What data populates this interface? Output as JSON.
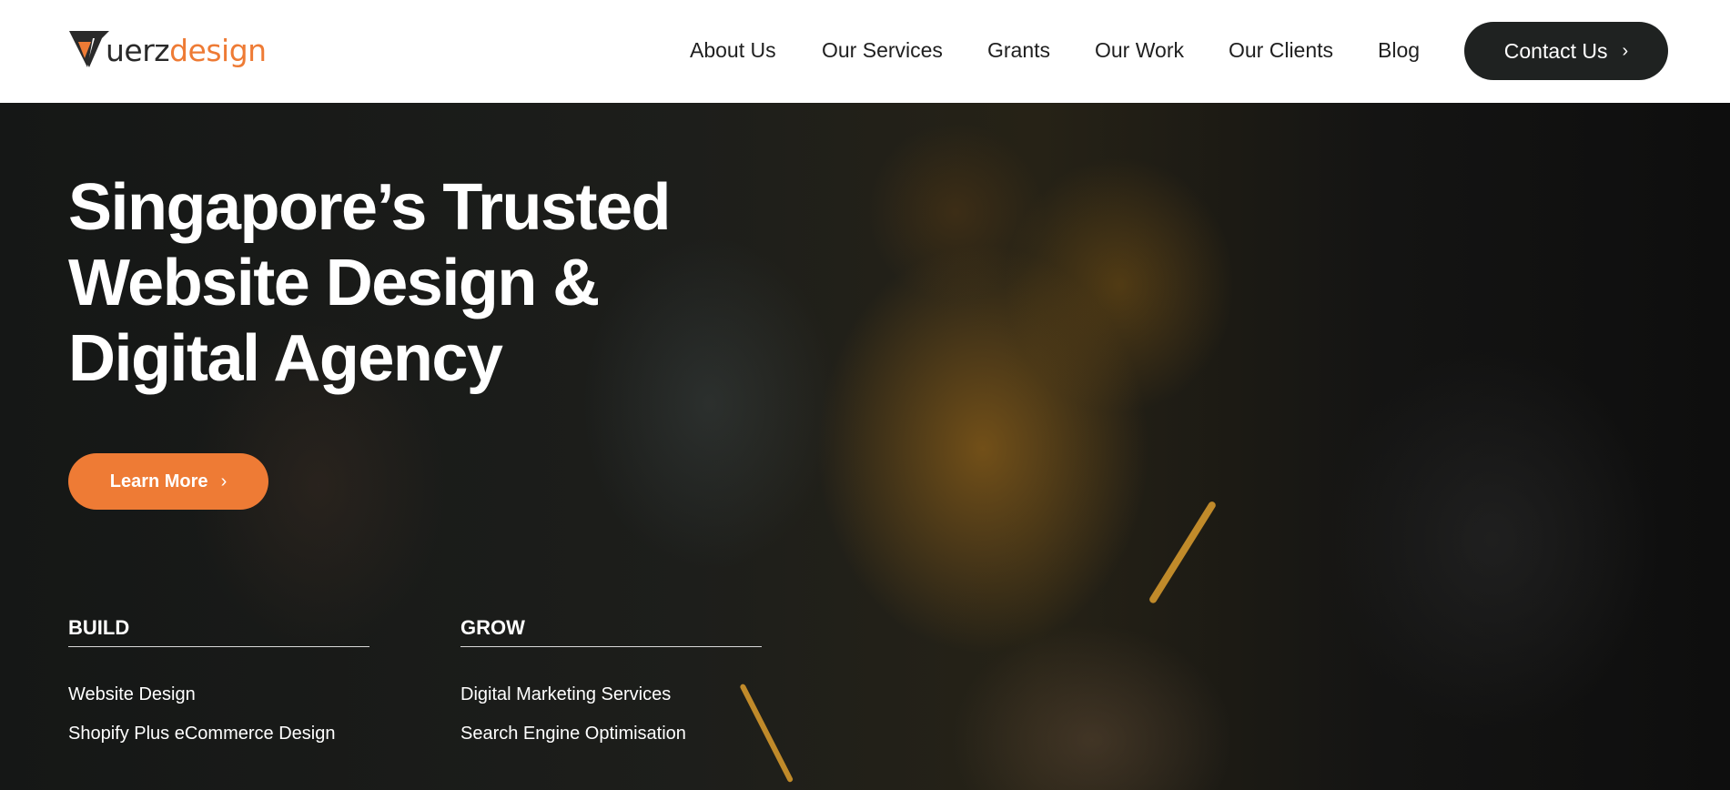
{
  "brand": {
    "logo_part1": "uerz",
    "logo_part2": "design",
    "dark_color": "#2a2a2a",
    "accent_color": "#ee7b35"
  },
  "nav": {
    "items": [
      "About Us",
      "Our Services",
      "Grants",
      "Our Work",
      "Our Clients",
      "Blog"
    ],
    "contact_label": "Contact Us",
    "contact_icon": "chevron-right-icon"
  },
  "hero": {
    "title_lines": [
      "Singapore’s Trusted",
      "Website Design &",
      "Digital Agency"
    ],
    "cta_label": "Learn More",
    "cta_icon": "chevron-right-icon"
  },
  "services": {
    "build": {
      "title": "BUILD",
      "links": [
        "Website Design",
        "Shopify Plus eCommerce Design"
      ]
    },
    "grow": {
      "title": "GROW",
      "links": [
        "Digital Marketing Services",
        "Search Engine Optimisation"
      ]
    }
  }
}
